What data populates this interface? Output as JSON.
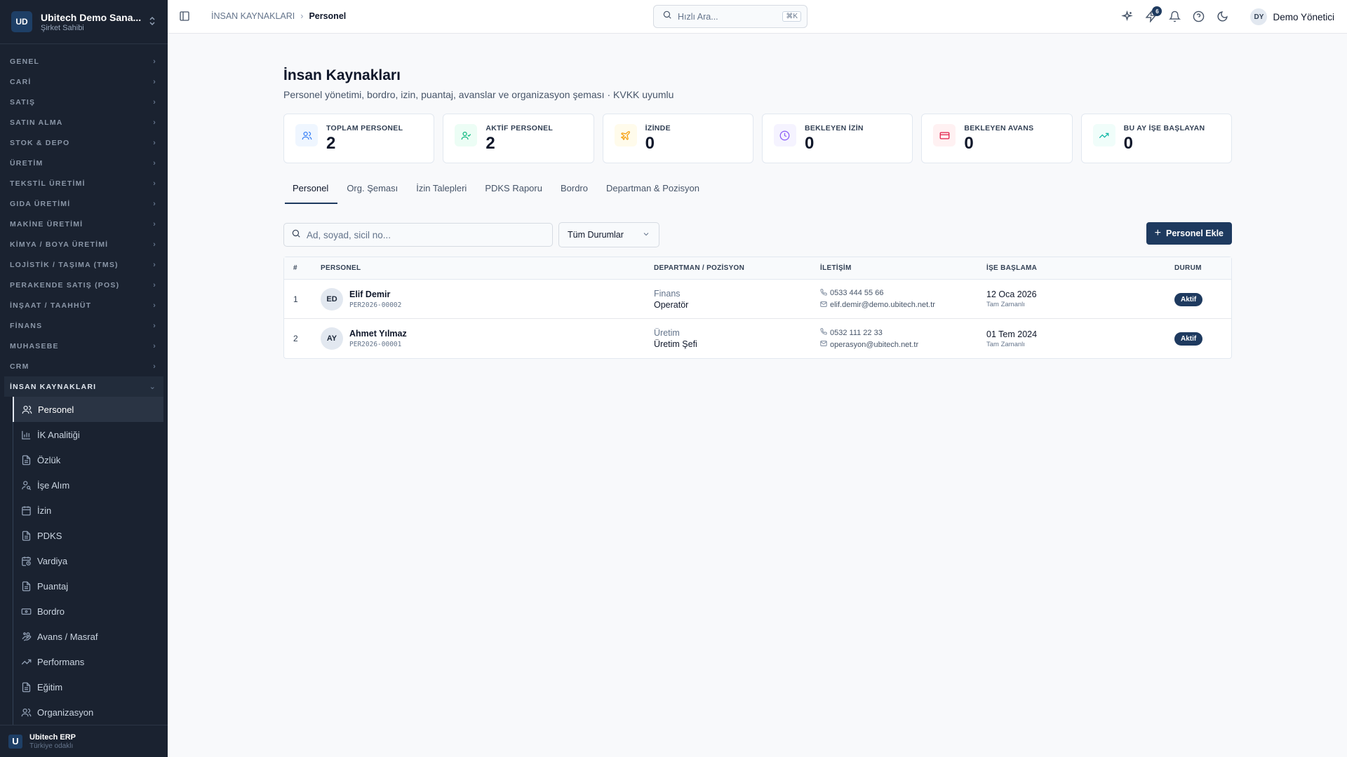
{
  "workspace": {
    "badge": "UD",
    "name": "Ubitech Demo Sana...",
    "role": "Şirket Sahibi"
  },
  "sidebar": {
    "sections": [
      {
        "label": "GENEL"
      },
      {
        "label": "CARİ"
      },
      {
        "label": "SATIŞ"
      },
      {
        "label": "SATIN ALMA"
      },
      {
        "label": "STOK & DEPO"
      },
      {
        "label": "ÜRETİM"
      },
      {
        "label": "TEKSTİL ÜRETİMİ"
      },
      {
        "label": "GIDA ÜRETİMİ"
      },
      {
        "label": "MAKİNE ÜRETİMİ"
      },
      {
        "label": "KİMYA / BOYA ÜRETİMİ"
      },
      {
        "label": "LOJİSTİK / TAŞIMA (TMS)"
      },
      {
        "label": "PERAKENDE SATIŞ (POS)"
      },
      {
        "label": "İNŞAAT / TAAHHÜT"
      },
      {
        "label": "FİNANS"
      },
      {
        "label": "MUHASEBE"
      },
      {
        "label": "CRM"
      }
    ],
    "open_section": "İNSAN KAYNAKLARI",
    "items": [
      {
        "label": "Personel",
        "icon": "users-icon"
      },
      {
        "label": "İK Analitiği",
        "icon": "bar-chart-icon"
      },
      {
        "label": "Özlük",
        "icon": "file-icon"
      },
      {
        "label": "İşe Alım",
        "icon": "user-search-icon"
      },
      {
        "label": "İzin",
        "icon": "calendar-icon"
      },
      {
        "label": "PDKS",
        "icon": "file-icon"
      },
      {
        "label": "Vardiya",
        "icon": "calendar-clock-icon"
      },
      {
        "label": "Puantaj",
        "icon": "file-icon"
      },
      {
        "label": "Bordro",
        "icon": "banknote-icon"
      },
      {
        "label": "Avans / Masraf",
        "icon": "hand-coins-icon"
      },
      {
        "label": "Performans",
        "icon": "trending-up-icon"
      },
      {
        "label": "Eğitim",
        "icon": "file-icon"
      },
      {
        "label": "Organizasyon",
        "icon": "users-icon"
      }
    ],
    "footer": {
      "logo": "U",
      "title": "Ubitech ERP",
      "subtitle": "Türkiye odaklı"
    }
  },
  "topbar": {
    "breadcrumb_parent": "İNSAN KAYNAKLARI",
    "breadcrumb_current": "Personel",
    "search_placeholder": "Hızlı Ara...",
    "search_shortcut": "⌘K",
    "notification_count": "6",
    "user_initials": "DY",
    "user_name": "Demo Yönetici"
  },
  "page": {
    "title": "İnsan Kaynakları",
    "subtitle": "Personel yönetimi, bordro, izin, puantaj, avanslar ve organizasyon şeması · KVKK uyumlu"
  },
  "stats": [
    {
      "label": "TOPLAM PERSONEL",
      "value": "2",
      "icon": "users-icon",
      "color": "#3b82f6",
      "bg": "#eff6ff"
    },
    {
      "label": "AKTİF PERSONEL",
      "value": "2",
      "icon": "user-check-icon",
      "color": "#10b981",
      "bg": "#ecfdf5"
    },
    {
      "label": "İZİNDE",
      "value": "0",
      "icon": "plane-icon",
      "color": "#f59e0b",
      "bg": "#fffbeb"
    },
    {
      "label": "BEKLEYEN İZİN",
      "value": "0",
      "icon": "clock-icon",
      "color": "#8b5cf6",
      "bg": "#f5f3ff"
    },
    {
      "label": "BEKLEYEN AVANS",
      "value": "0",
      "icon": "credit-card-icon",
      "color": "#e11d48",
      "bg": "#fff1f2"
    },
    {
      "label": "BU AY İŞE BAŞLAYAN",
      "value": "0",
      "icon": "trending-up-icon",
      "color": "#14b8a6",
      "bg": "#f0fdfa"
    }
  ],
  "tabs": [
    {
      "label": "Personel",
      "active": true
    },
    {
      "label": "Org. Şeması"
    },
    {
      "label": "İzin Talepleri"
    },
    {
      "label": "PDKS Raporu"
    },
    {
      "label": "Bordro"
    },
    {
      "label": "Departman & Pozisyon"
    }
  ],
  "filters": {
    "search_placeholder": "Ad, soyad, sicil no...",
    "status_value": "Tüm Durumlar",
    "add_label": "Personel Ekle"
  },
  "table": {
    "headers": [
      "#",
      "PERSONEL",
      "DEPARTMAN / POZİSYON",
      "İLETİŞİM",
      "İŞE BAŞLAMA",
      "DURUM"
    ],
    "rows": [
      {
        "num": "1",
        "initials": "ED",
        "name": "Elif Demir",
        "code": "PER2026-00002",
        "department": "Finans",
        "position": "Operatör",
        "phone": "0533 444 55 66",
        "email": "elif.demir@demo.ubitech.net.tr",
        "start_date": "12 Oca 2026",
        "employment": "Tam Zamanlı",
        "status": "Aktif"
      },
      {
        "num": "2",
        "initials": "AY",
        "name": "Ahmet Yılmaz",
        "code": "PER2026-00001",
        "department": "Üretim",
        "position": "Üretim Şefi",
        "phone": "0532 111 22 33",
        "email": "operasyon@ubitech.net.tr",
        "start_date": "01 Tem 2024",
        "employment": "Tam Zamanlı",
        "status": "Aktif"
      }
    ]
  }
}
